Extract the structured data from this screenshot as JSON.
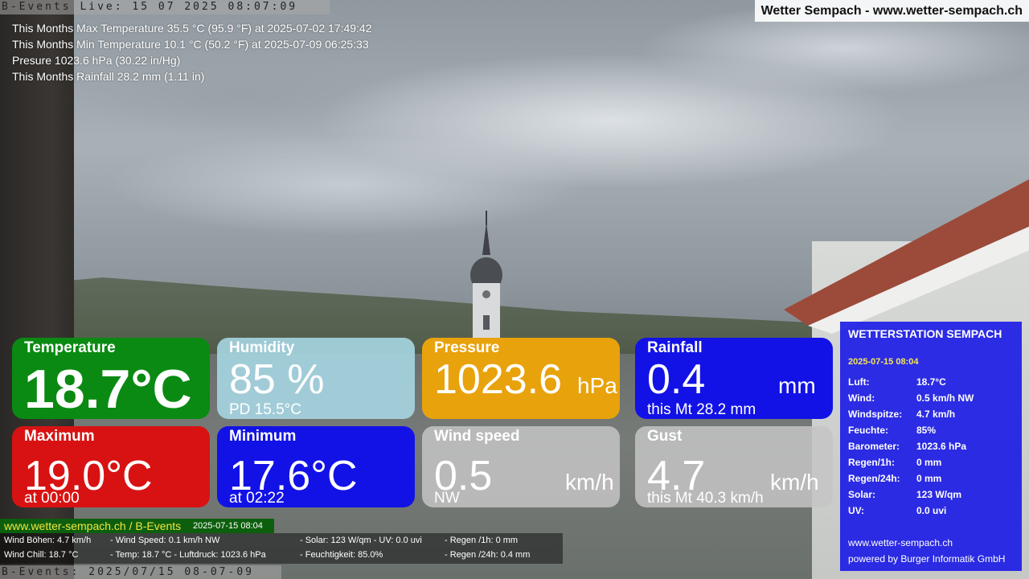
{
  "ticker_top": "B-Events Live: 15 07 2025 08:07:09",
  "site_title": "Wetter Sempach - www.wetter-sempach.ch",
  "stats": [
    "This Months Max Temperature 35.5 °C (95.9 °F) at 2025-07-02 17:49:42",
    "This Months Min Temperature 10.1 °C (50.2 °F) at 2025-07-09 06:25:33",
    "Presure 1023.6 hPa (30.22 in/Hg)",
    "This Months Rainfall 28.2 mm (1.11 in)"
  ],
  "tiles": {
    "temperature": {
      "label": "Temperature",
      "value": "18.7°C",
      "color": "#0a8a12"
    },
    "humidity": {
      "label": "Humidity",
      "value": "85 %",
      "sub": "PD 15.5°C",
      "color": "#a5d4e0"
    },
    "pressure": {
      "label": "Pressure",
      "value": "1023.6",
      "unit": "hPa",
      "color": "#e8a20c"
    },
    "rainfall": {
      "label": "Rainfall",
      "value": "0.4",
      "unit": "mm",
      "sub": "this Mt 28.2 mm",
      "color": "#1212e6"
    },
    "maximum": {
      "label": "Maximum",
      "value": "19.0°C",
      "sub": "at 00:00",
      "color": "#d81212"
    },
    "minimum": {
      "label": "Minimum",
      "value": "17.6°C",
      "sub": "at 02:22",
      "color": "#1212e6"
    },
    "wind_speed": {
      "label": "Wind speed",
      "value": "0.5",
      "unit": "km/h",
      "sub": "NW",
      "color": "#c4c4c4"
    },
    "gust": {
      "label": "Gust",
      "value": "4.7",
      "unit": "km/h",
      "sub": "this Mt 40.3 km/h",
      "color": "#c4c4c4"
    }
  },
  "green_bar": {
    "url": "www.wetter-sempach.ch / B-Events",
    "date": "2025-07-15 08:04"
  },
  "info_bar": {
    "wind_gusts": "Wind Böhen: 4.7 km/h",
    "wind_speed": "- Wind Speed: 0.1 km/h NW",
    "solar_uv": "- Solar: 123 W/qm   - UV: 0.0 uvi",
    "rain_1h": "- Regen /1h:   0 mm",
    "wind_chill": "Wind Chill: 18.7 °C",
    "temp_pressure": "- Temp: 18.7 °C  - Luftdruck: 1023.6 hPa",
    "humidity": "- Feuchtigkeit: 85.0%",
    "rain_24h": "- Regen /24h: 0.4 mm"
  },
  "ticker_bottom": "B-Events: 2025/07/15 08-07-09",
  "station": {
    "title": "WETTERSTATION SEMPACH",
    "date": "2025-07-15 08:04",
    "rows": [
      {
        "key": "Luft:",
        "value": "18.7°C"
      },
      {
        "key": "Wind:",
        "value": "0.5 km/h  NW"
      },
      {
        "key": "Windspitze:",
        "value": "4.7 km/h"
      },
      {
        "key": "Feuchte:",
        "value": "85%"
      },
      {
        "key": "Barometer:",
        "value": "1023.6 hPa"
      },
      {
        "key": "Regen/1h:",
        "value": "0 mm"
      },
      {
        "key": "Regen/24h:",
        "value": "0 mm"
      },
      {
        "key": "Solar:",
        "value": "123 W/qm"
      },
      {
        "key": "UV:",
        "value": "0.0 uvi"
      }
    ],
    "footer_url": "www.wetter-sempach.ch",
    "footer_credit": "powered by Burger Informatik GmbH"
  }
}
